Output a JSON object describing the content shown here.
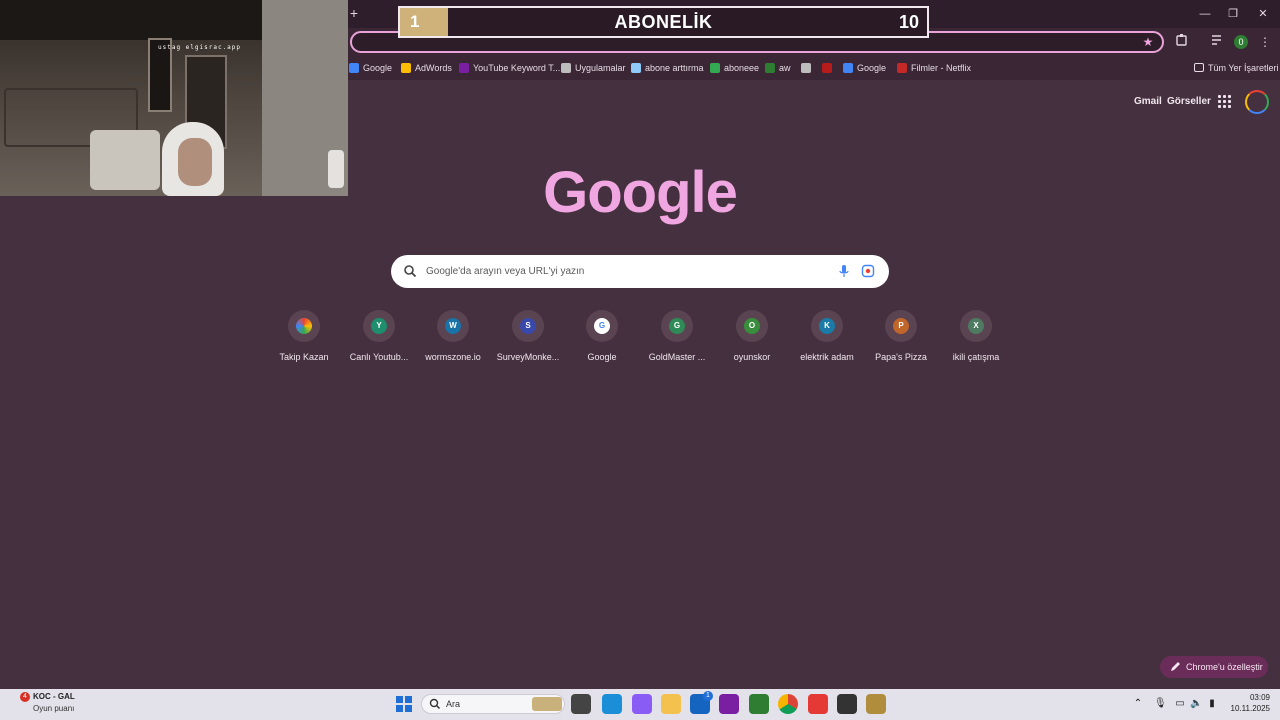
{
  "overlay": {
    "current_count": "1",
    "title": "ABONELİK",
    "goal": "10"
  },
  "webcam": {
    "watermark": "ustag elgisrac.app"
  },
  "browser": {
    "new_tab_symbol": "+",
    "window_controls": [
      "—",
      "❐",
      "✕"
    ],
    "profile_badge": "0"
  },
  "bookmarks": {
    "items": [
      {
        "label": "Google",
        "color": "#4285f4"
      },
      {
        "label": "AdWords",
        "color": "#fbbc05"
      },
      {
        "label": "YouTube Keyword T...",
        "color": "#7b1fa2"
      },
      {
        "label": "Uygulamalar",
        "color": "#bdbdbd"
      },
      {
        "label": "abone arttırma",
        "color": "#90caf9"
      },
      {
        "label": "aboneee",
        "color": "#34a853"
      },
      {
        "label": "aw",
        "color": "#2e7d32"
      },
      {
        "label": "",
        "color": "#bdbdbd"
      },
      {
        "label": "",
        "color": "#b71c1c"
      },
      {
        "label": "Google",
        "color": "#4285f4"
      },
      {
        "label": "Filmler - Netflix",
        "color": "#c62828"
      }
    ],
    "all_bookmarks": "Tüm Yer İşaretleri"
  },
  "google": {
    "gmail": "Gmail",
    "images": "Görseller",
    "logo": "Google",
    "search_placeholder": "Google'da arayın veya URL'yi yazın"
  },
  "shortcuts": [
    {
      "label": "Takip Kazan",
      "letter": "",
      "color": "#34a853"
    },
    {
      "label": "Canlı Youtub...",
      "letter": "Y",
      "color": "#1e8e6e"
    },
    {
      "label": "wormszone.io",
      "letter": "W",
      "color": "#1a73a8"
    },
    {
      "label": "SurveyMonke...",
      "letter": "S",
      "color": "#3949ab"
    },
    {
      "label": "Google",
      "letter": "G",
      "color": "#ffffff"
    },
    {
      "label": "GoldMaster ...",
      "letter": "G",
      "color": "#2e8b57"
    },
    {
      "label": "oyunskor",
      "letter": "O",
      "color": "#388e3c"
    },
    {
      "label": "elektrik adam",
      "letter": "K",
      "color": "#1c7aa8"
    },
    {
      "label": "Papa's Pizza",
      "letter": "P",
      "color": "#c0662a"
    },
    {
      "label": "ikili çatışma",
      "letter": "X",
      "color": "#4f7a62"
    }
  ],
  "customize": {
    "label": "Chrome'u özelleştir"
  },
  "taskbar": {
    "weather_badge": "4",
    "weather_title": "KOC - GAL",
    "weather_subtitle": "Oyun puanı",
    "search_label": "Ara",
    "apps": [
      {
        "name": "task-view",
        "color": "#444444"
      },
      {
        "name": "edge",
        "color": "#1a8fd8"
      },
      {
        "name": "copilot",
        "color": "#8a5cf6"
      },
      {
        "name": "file-explorer",
        "color": "#f2c14e"
      },
      {
        "name": "store",
        "color": "#1565c0"
      },
      {
        "name": "app-purple",
        "color": "#7b1fa2"
      },
      {
        "name": "xbox",
        "color": "#2e7d32"
      },
      {
        "name": "chrome",
        "color": "#db4437"
      },
      {
        "name": "youtube",
        "color": "#e53935"
      },
      {
        "name": "app-dark",
        "color": "#333333"
      },
      {
        "name": "league",
        "color": "#b08d3c"
      }
    ],
    "store_badge": "1",
    "time": "03:09",
    "date": "10.11.2025"
  }
}
